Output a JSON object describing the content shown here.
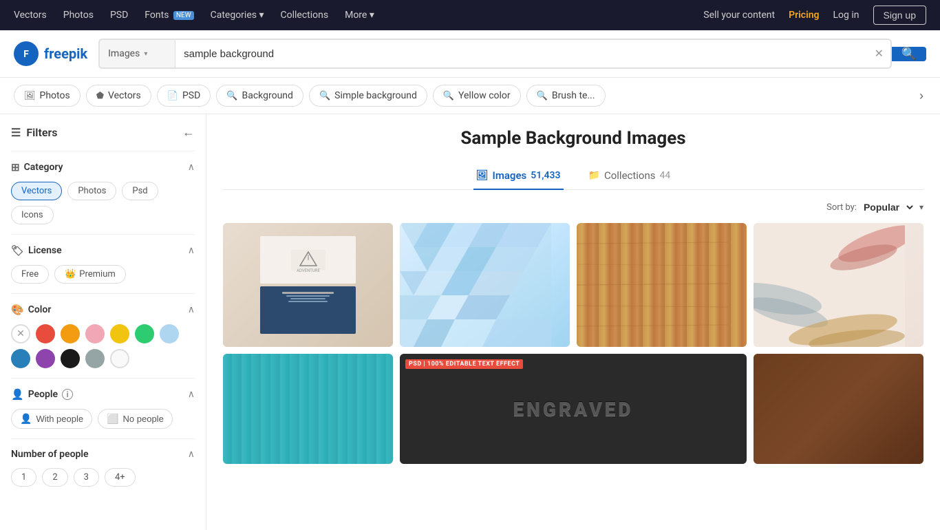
{
  "topnav": {
    "items": [
      {
        "label": "Vectors",
        "id": "vectors"
      },
      {
        "label": "Photos",
        "id": "photos"
      },
      {
        "label": "PSD",
        "id": "psd"
      },
      {
        "label": "Fonts",
        "id": "fonts",
        "badge": "NEW"
      },
      {
        "label": "Categories",
        "id": "categories",
        "hasDropdown": true
      },
      {
        "label": "Collections",
        "id": "collections"
      },
      {
        "label": "More",
        "id": "more",
        "hasDropdown": true
      }
    ],
    "right": {
      "sell": "Sell your content",
      "pricing": "Pricing",
      "login": "Log in",
      "signup": "Sign up"
    }
  },
  "search": {
    "type": "Images",
    "placeholder": "sample background",
    "value": "sample background"
  },
  "filter_chips": [
    {
      "label": "Photos",
      "icon": "🖼"
    },
    {
      "label": "Vectors",
      "icon": "⬟"
    },
    {
      "label": "PSD",
      "icon": "📄"
    },
    {
      "label": "Background",
      "icon": "🔍"
    },
    {
      "label": "Simple background",
      "icon": "🔍"
    },
    {
      "label": "Yellow color",
      "icon": "🔍"
    },
    {
      "label": "Brush te...",
      "icon": "🔍"
    }
  ],
  "sidebar": {
    "title": "Filters",
    "sections": [
      {
        "id": "category",
        "title": "Category",
        "icon": "☰",
        "tags": [
          {
            "label": "Vectors",
            "active": true
          },
          {
            "label": "Photos",
            "active": false
          },
          {
            "label": "Psd",
            "active": false
          },
          {
            "label": "Icons",
            "active": false
          }
        ]
      },
      {
        "id": "license",
        "title": "License",
        "icon": "📋",
        "tags": [
          {
            "label": "Free",
            "active": false
          },
          {
            "label": "Premium",
            "active": false
          }
        ]
      },
      {
        "id": "color",
        "title": "Color",
        "icon": "🎨",
        "colors": [
          {
            "value": "clear",
            "bg": "#fff",
            "clear": true
          },
          {
            "value": "red",
            "bg": "#e74c3c"
          },
          {
            "value": "orange",
            "bg": "#f39c12"
          },
          {
            "value": "pink",
            "bg": "#f1a7b5"
          },
          {
            "value": "yellow",
            "bg": "#f1c40f"
          },
          {
            "value": "green",
            "bg": "#2ecc71"
          },
          {
            "value": "light-blue",
            "bg": "#aed6f1"
          },
          {
            "value": "blue",
            "bg": "#2980b9"
          },
          {
            "value": "purple",
            "bg": "#8e44ad"
          },
          {
            "value": "black",
            "bg": "#1a1a1a"
          },
          {
            "value": "gray",
            "bg": "#95a5a6"
          },
          {
            "value": "white",
            "bg": "#f9f9f9",
            "border": true
          }
        ]
      },
      {
        "id": "people",
        "title": "People",
        "info": true,
        "people_options": [
          {
            "label": "With people",
            "icon": "👤"
          },
          {
            "label": "No people",
            "icon": "⬜"
          }
        ]
      },
      {
        "id": "number-of-people",
        "title": "Number of people",
        "numbers": [
          "1",
          "2",
          "3",
          "4+"
        ]
      }
    ]
  },
  "content": {
    "title": "Sample Background Images",
    "tabs": [
      {
        "label": "Images",
        "count": "51,433",
        "icon": "🖼",
        "active": true
      },
      {
        "label": "Collections",
        "count": "44",
        "icon": "📁",
        "active": false
      }
    ],
    "sort": {
      "label": "Sort by:",
      "value": "Popular"
    },
    "images": [
      {
        "id": "img1",
        "type": "business",
        "alt": "Business card on beige background"
      },
      {
        "id": "img2",
        "type": "polygon",
        "alt": "Blue polygon geometric background"
      },
      {
        "id": "img3",
        "type": "wood",
        "alt": "Wood grain texture background"
      },
      {
        "id": "img4",
        "type": "brush",
        "alt": "Brush stroke paint background"
      },
      {
        "id": "img5",
        "type": "teal",
        "alt": "Teal wooden planks background"
      },
      {
        "id": "img6",
        "type": "engraved",
        "alt": "Engraved text effect PSD",
        "badge": "PSD"
      },
      {
        "id": "img7",
        "type": "brown",
        "alt": "Brown solid color background"
      }
    ]
  }
}
